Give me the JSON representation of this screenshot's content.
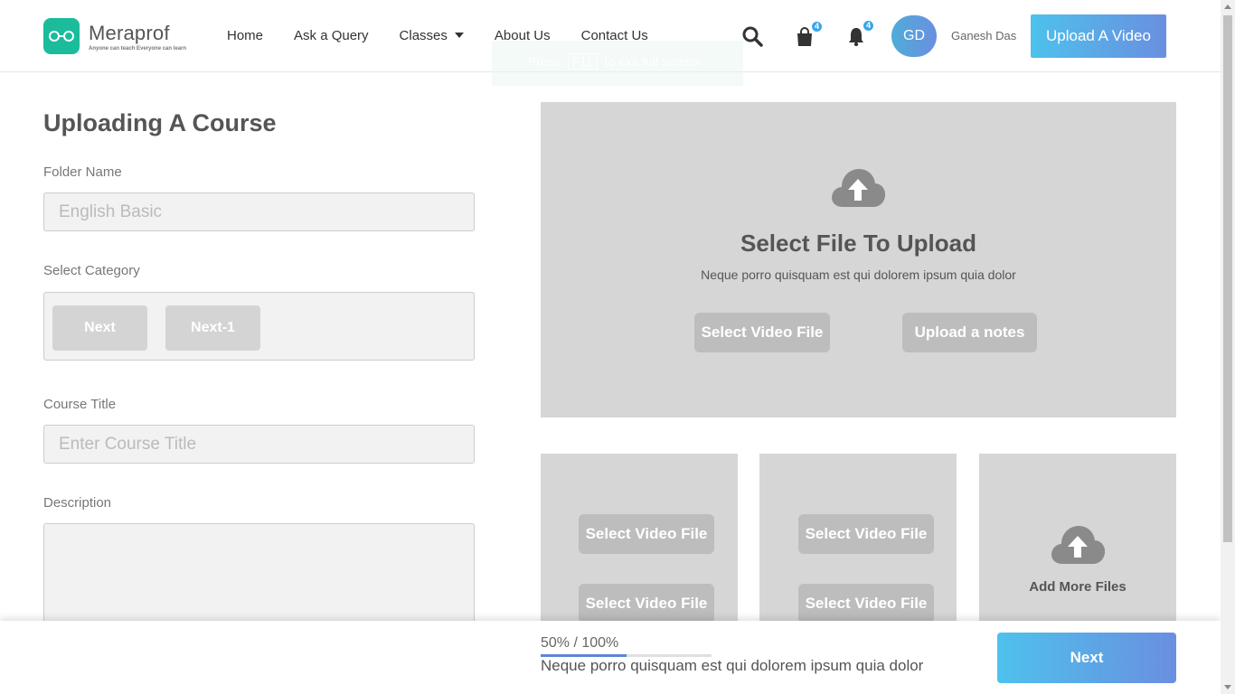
{
  "brand": {
    "name": "Meraprof",
    "tagline": "Anyone can teach Everyone can learn",
    "accent": "#1abc9c"
  },
  "nav": {
    "home": "Home",
    "ask": "Ask a Query",
    "classes": "Classes",
    "about": "About Us",
    "contact": "Contact Us"
  },
  "fullscreen_hint": {
    "press": "Press",
    "key": "F11",
    "rest": "to exit full screen"
  },
  "header": {
    "cart_count": "4",
    "notif_count": "4",
    "avatar_initials": "GD",
    "user_name": "Ganesh Das",
    "upload_video": "Upload A Video"
  },
  "form": {
    "title": "Uploading A Course",
    "folder_label": "Folder Name",
    "folder_placeholder": "English Basic",
    "category_label": "Select Category",
    "category_buttons": [
      "Next",
      "Next-1"
    ],
    "course_title_label": "Course Title",
    "course_title_placeholder": "Enter Course Title",
    "description_label": "Description"
  },
  "upload": {
    "title": "Select File To Upload",
    "subtitle": "Neque porro quisquam est qui dolorem ipsum quia dolor",
    "select_video": "Select Video File",
    "upload_notes": "Upload a notes",
    "add_more": "Add More Files"
  },
  "footer": {
    "progress_text": "50% / 100%",
    "progress_value": 0.5,
    "description": "Neque porro quisquam est qui dolorem ipsum quia dolor",
    "next": "Next"
  },
  "colors": {
    "gradient_start": "#4ec1ec",
    "gradient_end": "#6a8fe0",
    "badge": "#3da5e8",
    "panel": "#d6d6d6"
  }
}
